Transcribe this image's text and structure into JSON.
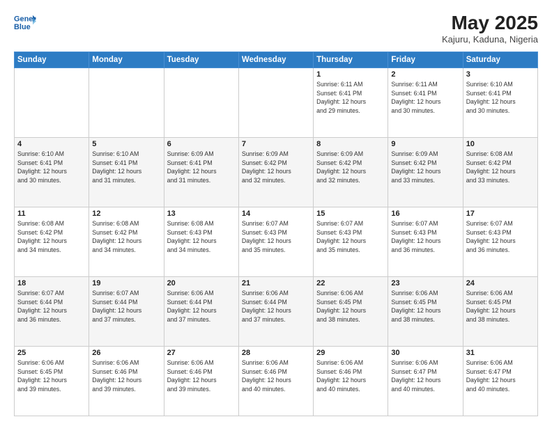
{
  "logo": {
    "line1": "General",
    "line2": "Blue"
  },
  "title": "May 2025",
  "subtitle": "Kajuru, Kaduna, Nigeria",
  "days_of_week": [
    "Sunday",
    "Monday",
    "Tuesday",
    "Wednesday",
    "Thursday",
    "Friday",
    "Saturday"
  ],
  "weeks": [
    [
      {
        "num": "",
        "info": ""
      },
      {
        "num": "",
        "info": ""
      },
      {
        "num": "",
        "info": ""
      },
      {
        "num": "",
        "info": ""
      },
      {
        "num": "1",
        "info": "Sunrise: 6:11 AM\nSunset: 6:41 PM\nDaylight: 12 hours\nand 29 minutes."
      },
      {
        "num": "2",
        "info": "Sunrise: 6:11 AM\nSunset: 6:41 PM\nDaylight: 12 hours\nand 30 minutes."
      },
      {
        "num": "3",
        "info": "Sunrise: 6:10 AM\nSunset: 6:41 PM\nDaylight: 12 hours\nand 30 minutes."
      }
    ],
    [
      {
        "num": "4",
        "info": "Sunrise: 6:10 AM\nSunset: 6:41 PM\nDaylight: 12 hours\nand 30 minutes."
      },
      {
        "num": "5",
        "info": "Sunrise: 6:10 AM\nSunset: 6:41 PM\nDaylight: 12 hours\nand 31 minutes."
      },
      {
        "num": "6",
        "info": "Sunrise: 6:09 AM\nSunset: 6:41 PM\nDaylight: 12 hours\nand 31 minutes."
      },
      {
        "num": "7",
        "info": "Sunrise: 6:09 AM\nSunset: 6:42 PM\nDaylight: 12 hours\nand 32 minutes."
      },
      {
        "num": "8",
        "info": "Sunrise: 6:09 AM\nSunset: 6:42 PM\nDaylight: 12 hours\nand 32 minutes."
      },
      {
        "num": "9",
        "info": "Sunrise: 6:09 AM\nSunset: 6:42 PM\nDaylight: 12 hours\nand 33 minutes."
      },
      {
        "num": "10",
        "info": "Sunrise: 6:08 AM\nSunset: 6:42 PM\nDaylight: 12 hours\nand 33 minutes."
      }
    ],
    [
      {
        "num": "11",
        "info": "Sunrise: 6:08 AM\nSunset: 6:42 PM\nDaylight: 12 hours\nand 34 minutes."
      },
      {
        "num": "12",
        "info": "Sunrise: 6:08 AM\nSunset: 6:42 PM\nDaylight: 12 hours\nand 34 minutes."
      },
      {
        "num": "13",
        "info": "Sunrise: 6:08 AM\nSunset: 6:43 PM\nDaylight: 12 hours\nand 34 minutes."
      },
      {
        "num": "14",
        "info": "Sunrise: 6:07 AM\nSunset: 6:43 PM\nDaylight: 12 hours\nand 35 minutes."
      },
      {
        "num": "15",
        "info": "Sunrise: 6:07 AM\nSunset: 6:43 PM\nDaylight: 12 hours\nand 35 minutes."
      },
      {
        "num": "16",
        "info": "Sunrise: 6:07 AM\nSunset: 6:43 PM\nDaylight: 12 hours\nand 36 minutes."
      },
      {
        "num": "17",
        "info": "Sunrise: 6:07 AM\nSunset: 6:43 PM\nDaylight: 12 hours\nand 36 minutes."
      }
    ],
    [
      {
        "num": "18",
        "info": "Sunrise: 6:07 AM\nSunset: 6:44 PM\nDaylight: 12 hours\nand 36 minutes."
      },
      {
        "num": "19",
        "info": "Sunrise: 6:07 AM\nSunset: 6:44 PM\nDaylight: 12 hours\nand 37 minutes."
      },
      {
        "num": "20",
        "info": "Sunrise: 6:06 AM\nSunset: 6:44 PM\nDaylight: 12 hours\nand 37 minutes."
      },
      {
        "num": "21",
        "info": "Sunrise: 6:06 AM\nSunset: 6:44 PM\nDaylight: 12 hours\nand 37 minutes."
      },
      {
        "num": "22",
        "info": "Sunrise: 6:06 AM\nSunset: 6:45 PM\nDaylight: 12 hours\nand 38 minutes."
      },
      {
        "num": "23",
        "info": "Sunrise: 6:06 AM\nSunset: 6:45 PM\nDaylight: 12 hours\nand 38 minutes."
      },
      {
        "num": "24",
        "info": "Sunrise: 6:06 AM\nSunset: 6:45 PM\nDaylight: 12 hours\nand 38 minutes."
      }
    ],
    [
      {
        "num": "25",
        "info": "Sunrise: 6:06 AM\nSunset: 6:45 PM\nDaylight: 12 hours\nand 39 minutes."
      },
      {
        "num": "26",
        "info": "Sunrise: 6:06 AM\nSunset: 6:46 PM\nDaylight: 12 hours\nand 39 minutes."
      },
      {
        "num": "27",
        "info": "Sunrise: 6:06 AM\nSunset: 6:46 PM\nDaylight: 12 hours\nand 39 minutes."
      },
      {
        "num": "28",
        "info": "Sunrise: 6:06 AM\nSunset: 6:46 PM\nDaylight: 12 hours\nand 40 minutes."
      },
      {
        "num": "29",
        "info": "Sunrise: 6:06 AM\nSunset: 6:46 PM\nDaylight: 12 hours\nand 40 minutes."
      },
      {
        "num": "30",
        "info": "Sunrise: 6:06 AM\nSunset: 6:47 PM\nDaylight: 12 hours\nand 40 minutes."
      },
      {
        "num": "31",
        "info": "Sunrise: 6:06 AM\nSunset: 6:47 PM\nDaylight: 12 hours\nand 40 minutes."
      }
    ]
  ]
}
